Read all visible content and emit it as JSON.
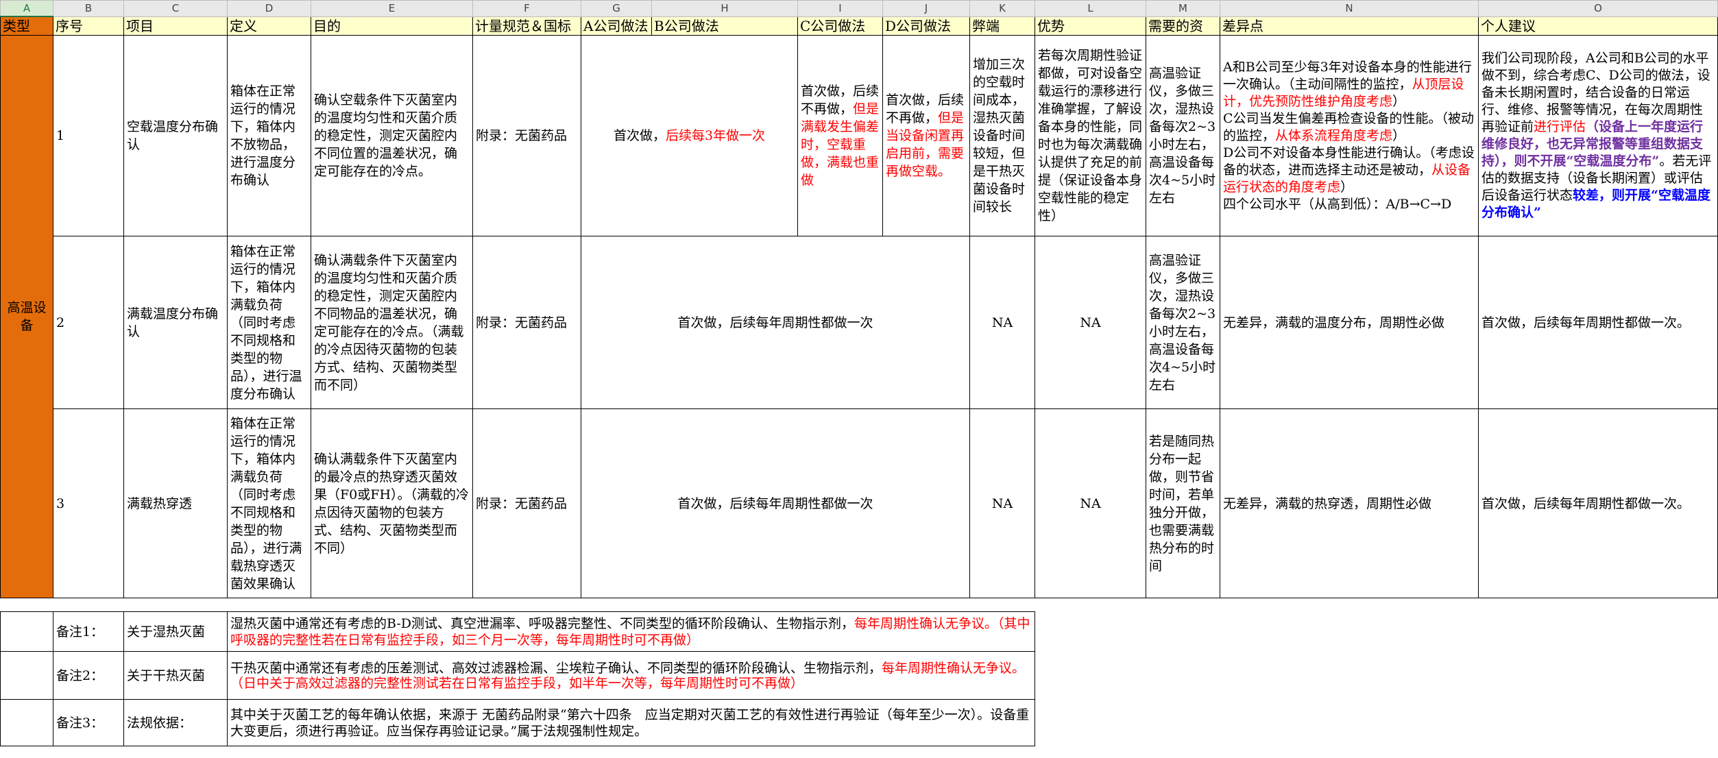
{
  "sheet": {
    "columns": [
      "A",
      "B",
      "C",
      "D",
      "E",
      "F",
      "G",
      "H",
      "I",
      "J",
      "K",
      "L",
      "M",
      "N",
      "O"
    ],
    "headers": {
      "type": "类型",
      "no": "序号",
      "item": "项目",
      "definition": "定义",
      "purpose": "目的",
      "standard": "计量规范＆国标",
      "company_a": "A公司做法",
      "company_b": "B公司做法",
      "company_c": "C公司做法",
      "company_d": "D公司做法",
      "drawback": "弊端",
      "advantage": "优势",
      "resources": "需要的资",
      "difference": "差异点",
      "suggestion": "个人建议"
    },
    "category": "高温设备",
    "rows": [
      {
        "no": "1",
        "item": "空载温度分布确认",
        "definition": "箱体在正常运行的情况下，箱体内不放物品，进行温度分布确认",
        "purpose": "确认空载条件下灭菌室内的温度均匀性和灭菌介质的稳定性，测定灭菌腔内不同位置的温差状况，确定可能存在的冷点。",
        "standard": "附录：无菌药品",
        "ab_normal": "首次做，",
        "ab_red": "后续每3年做一次",
        "c_normal": "首次做，后续不再做，",
        "c_red": "但是满载发生偏差时，空载重做，满载也重做",
        "d_normal": "首次做，后续不再做，",
        "d_red": "但是当设备闲置再启用前，需要再做空载。",
        "drawback": "增加三次的空载时间成本，湿热灭菌设备时间较短，但是干热灭菌设备时间较长",
        "advantage": "若每次周期性验证都做，可对设备空载运行的漂移进行准确掌握，了解设备本身的性能，同时也为每次满载确认提供了充足的前提（保证设备本身空载性能的稳定性）",
        "resources": "高温验证仪，多做三次，湿热设备每次2~3小时左右，高温设备每次4~5小时左右",
        "diff_1": "A和B公司至少每3年对设备本身的性能进行一次确认。（主动间隔性的监控，",
        "diff_1_red": "从顶层设计，优先预防性维护角度考虑",
        "diff_1_end": "）",
        "diff_2": "C公司当发生偏差再检查设备的性能。（被动的监控，",
        "diff_2_red": "从体系流程角度考虑",
        "diff_2_end": "）",
        "diff_3": "D公司不对设备本身性能进行确认。（考虑设备的状态，进而选择主动还是被动，",
        "diff_3_red": "从设备运行状态的角度考虑",
        "diff_3_end": "）",
        "diff_4": "四个公司水平（从高到低）：A/B→C→D",
        "sug_1": "我们公司现阶段，A公司和B公司的水平做不到，综合考虑C、D公司的做法，设备未长期闲置时，结合设备的日常运行、维修、报警等情况，在每次周期性再验证前",
        "sug_red": "进行评估",
        "sug_purple": "（设备上一年度运行维修良好，也无异常报警等重组数据支持），则不开展“空载温度分布”",
        "sug_2": "。若无评估的数据支持（设备长期闲置）或评估后设备运行状态",
        "sug_blue": "较差，则开展“空载温度分布确认”"
      },
      {
        "no": "2",
        "item": "满载温度分布确认",
        "definition": "箱体在正常运行的情况下，箱体内满载负荷（同时考虑不同规格和类型的物品），进行温度分布确认",
        "purpose": "确认满载条件下灭菌室内的温度均匀性和灭菌介质的稳定性，测定灭菌腔内不同物品的温差状况，确定可能存在的冷点。（满载的冷点因待灭菌物的包装方式、结构、灭菌物类型而不同）",
        "standard": "附录：无菌药品",
        "practice": "首次做，后续每年周期性都做一次",
        "drawback": "NA",
        "advantage": "NA",
        "resources": "高温验证仪，多做三次，湿热设备每次2~3小时左右，高温设备每次4~5小时左右",
        "difference": "无差异，满载的温度分布，周期性必做",
        "suggestion": "首次做，后续每年周期性都做一次。"
      },
      {
        "no": "3",
        "item": "满载热穿透",
        "definition": "箱体在正常运行的情况下，箱体内满载负荷（同时考虑不同规格和类型的物品），进行满载热穿透灭菌效果确认",
        "purpose": "确认满载条件下灭菌室内的最冷点的热穿透灭菌效果（F0或FH）。（满载的冷点因待灭菌物的包装方式、结构、灭菌物类型而不同）",
        "standard": "附录：无菌药品",
        "practice": "首次做，后续每年周期性都做一次",
        "drawback": "NA",
        "advantage": "NA",
        "resources": "若是随同热分布一起做，则节省时间，若单独分开做，也需要满载热分布的时间",
        "difference": "无差异，满载的热穿透，周期性必做",
        "suggestion": "首次做，后续每年周期性都做一次。"
      }
    ],
    "notes": [
      {
        "label": "备注1：",
        "title": "关于湿热灭菌",
        "text": "湿热灭菌中通常还有考虑的B-D测试、真空泄漏率、呼吸器完整性、不同类型的循环阶段确认、生物指示剂，",
        "red": "每年周期性确认无争议。（其中呼吸器的完整性若在日常有监控手段，如三个月一次等，每年周期性时可不再做）"
      },
      {
        "label": "备注2：",
        "title": "关于干热灭菌",
        "text": "干热灭菌中通常还有考虑的压差测试、高效过滤器检漏、尘埃粒子确认、不同类型的循环阶段确认、生物指示剂，",
        "red": "每年周期性确认无争议。（日中关于高效过滤器的完整性测试若在日常有监控手段，如半年一次等，每年周期性时可不再做）"
      },
      {
        "label": "备注3：",
        "title": "法规依据：",
        "text": "其中关于灭菌工艺的每年确认依据，来源于 无菌药品附录“第六十四条　应当定期对灭菌工艺的有效性进行再验证（每年至少一次）。设备重大变更后，须进行再验证。应当保存再验证记录。”属于法规强制性规定。",
        "red": ""
      }
    ],
    "colors": {
      "category_fill": "#e46c0a",
      "header_fill": "#ffffcc",
      "emphasis_red": "#ff0000",
      "emphasis_purple": "#7030a0",
      "emphasis_blue": "#0000ff"
    }
  }
}
